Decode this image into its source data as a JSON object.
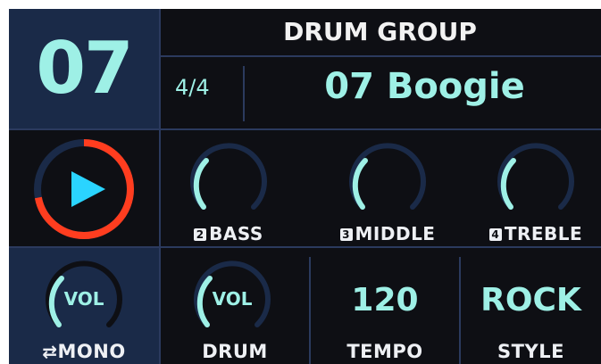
{
  "preset": {
    "number": "07"
  },
  "header": {
    "title": "DRUM GROUP"
  },
  "pattern": {
    "time_signature": "4/4",
    "name": "07 Boogie"
  },
  "transport": {
    "play_icon": "play-icon",
    "progress": 0.72,
    "ring_color": "#ff3d1f",
    "play_color": "#2ad4ff"
  },
  "eq": {
    "bass": {
      "badge": "2",
      "label": "BASS"
    },
    "middle": {
      "badge": "3",
      "label": "MIDDLE"
    },
    "treble": {
      "badge": "4",
      "label": "TREBLE"
    }
  },
  "bottom": {
    "mono": {
      "knob_text": "VOL",
      "label": "MONO",
      "icon": "swap-icon"
    },
    "drum": {
      "knob_text": "VOL",
      "label": "DRUM"
    },
    "tempo": {
      "value": "120",
      "label": "TEMPO"
    },
    "style": {
      "value": "ROCK",
      "label": "STYLE"
    }
  },
  "colors": {
    "accent": "#9ef0e6",
    "panel": "#1a2a48",
    "background": "#0e0f14",
    "divider": "#2b3a5e"
  }
}
